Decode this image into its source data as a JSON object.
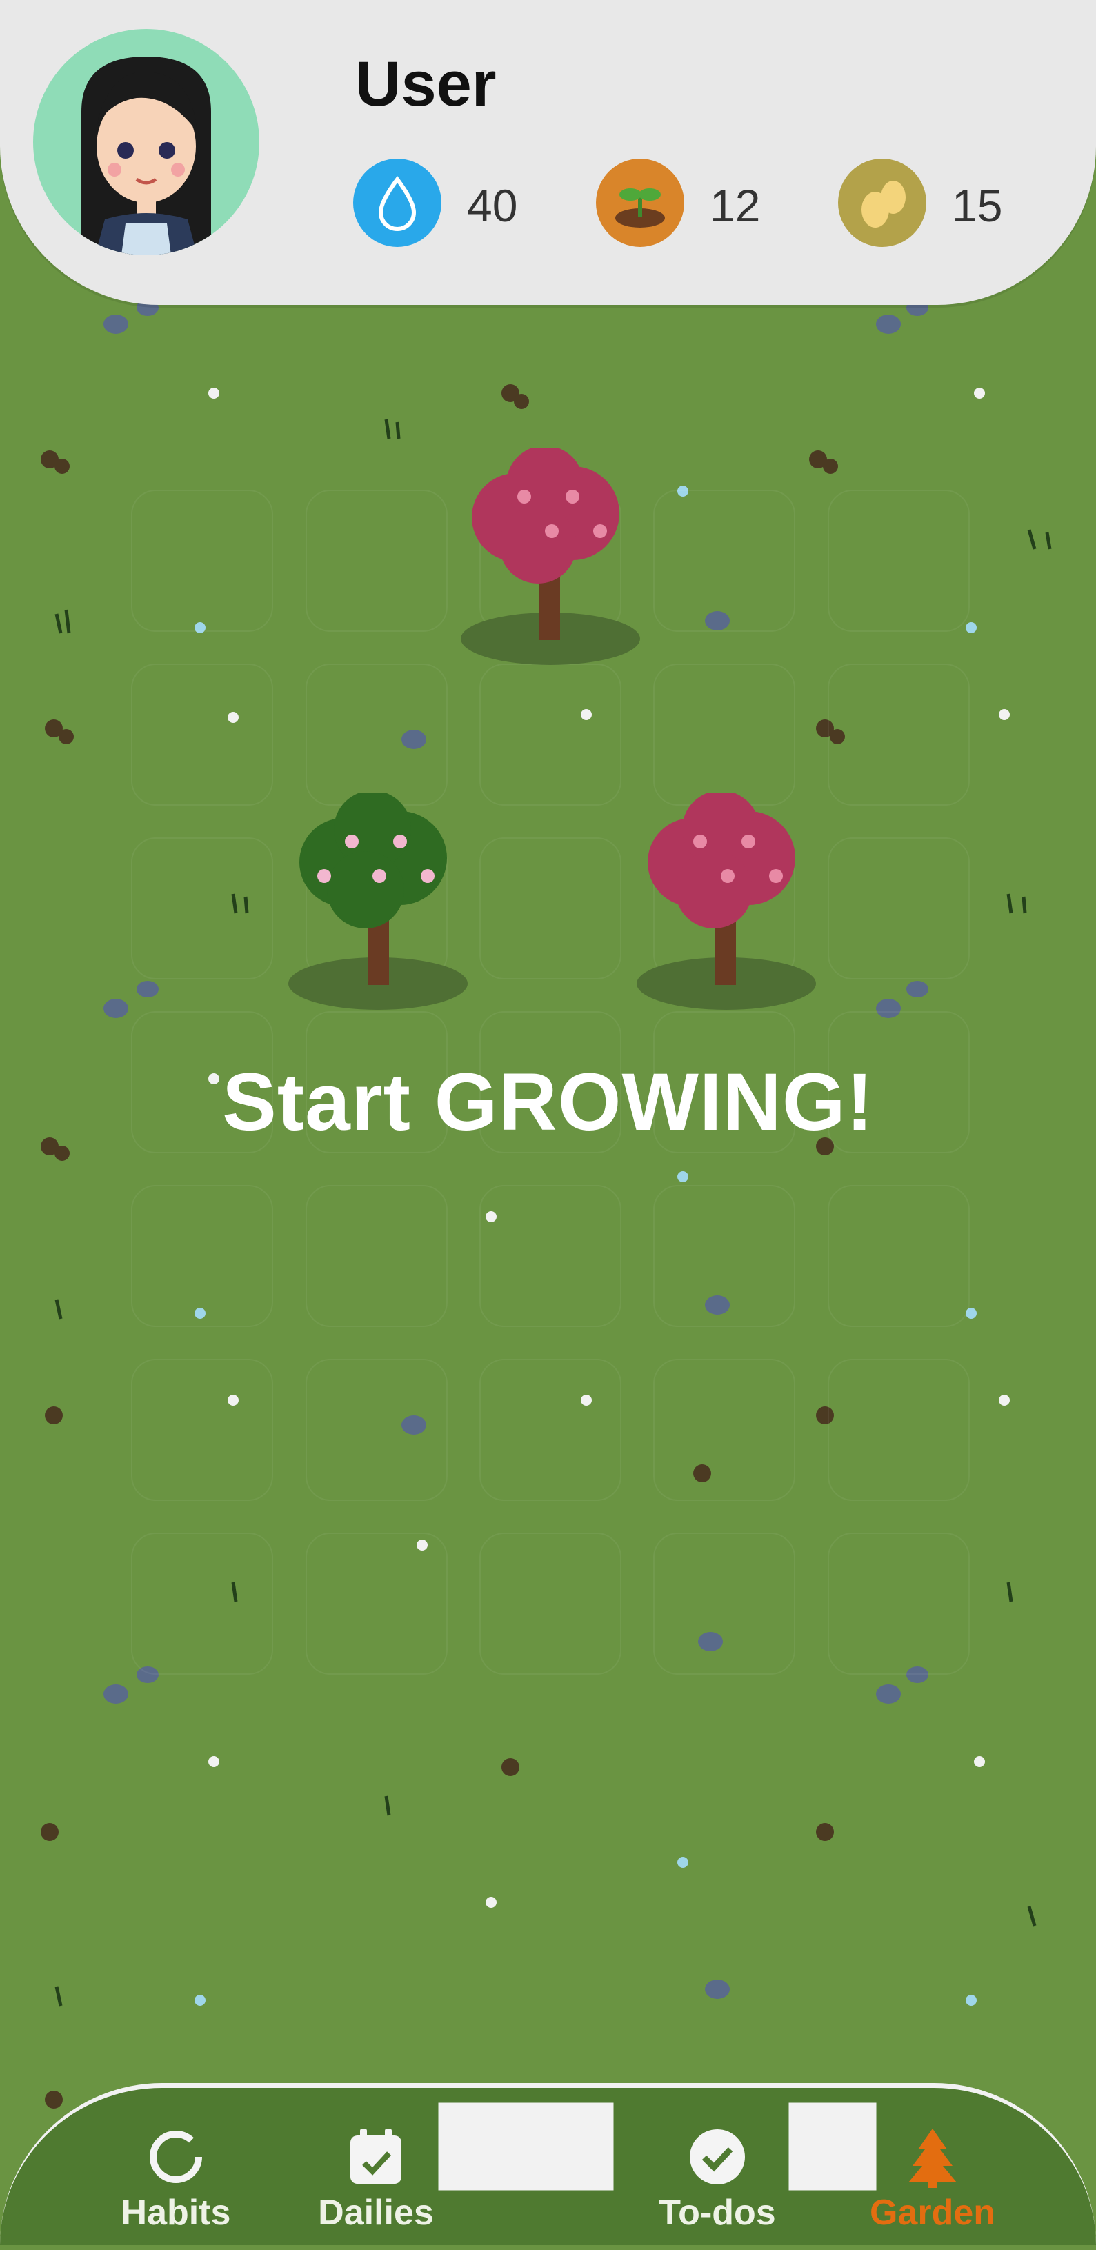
{
  "user": {
    "name": "User"
  },
  "stats": [
    {
      "id": "water",
      "value": "40",
      "color": "#29a8ea",
      "icon": "water-drop-icon"
    },
    {
      "id": "seeds",
      "value": "12",
      "color": "#d9852a",
      "icon": "sprout-icon"
    },
    {
      "id": "coins",
      "value": "15",
      "color": "#b3a24a",
      "icon": "eggs-icon"
    }
  ],
  "garden": {
    "headline": "Start GROWING!"
  },
  "nav": {
    "items": [
      {
        "label": "Habits",
        "icon": "habits-ring-icon",
        "active": false
      },
      {
        "label": "Dailies",
        "icon": "calendar-check-icon",
        "active": false
      },
      {
        "label": "To-dos",
        "icon": "checkmark-circle-icon",
        "active": false
      },
      {
        "label": "Garden",
        "icon": "tree-icon",
        "active": true
      }
    ],
    "active_color": "#e36d10"
  }
}
